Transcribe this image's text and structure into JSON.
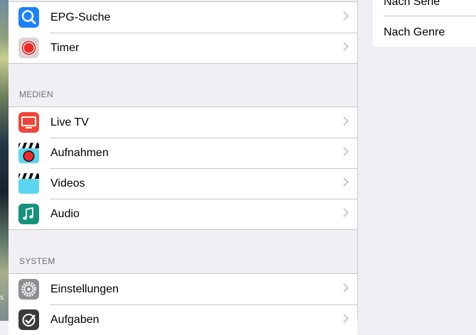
{
  "desktop": {
    "icon_label": "s"
  },
  "groups": [
    {
      "items": [
        {
          "label": "EPG-Suche",
          "icon": "search-icon"
        },
        {
          "label": "Timer",
          "icon": "record-icon"
        }
      ]
    },
    {
      "header": "MEDIEN",
      "items": [
        {
          "label": "Live TV",
          "icon": "tv-icon"
        },
        {
          "label": "Aufnahmen",
          "icon": "recordings-clapper-icon"
        },
        {
          "label": "Videos",
          "icon": "videos-clapper-icon"
        },
        {
          "label": "Audio",
          "icon": "music-note-icon"
        }
      ]
    },
    {
      "header": "SYSTEM",
      "items": [
        {
          "label": "Einstellungen",
          "icon": "gear-icon"
        },
        {
          "label": "Aufgaben",
          "icon": "tasks-check-icon"
        }
      ]
    }
  ],
  "right_panel": {
    "items": [
      "Nach Serie",
      "Nach Genre"
    ]
  },
  "colors": {
    "search_icon": "#1a82fb",
    "timer_icon": "#d0d0d0",
    "record_red": "#ef2b2b",
    "livetv_icon": "#f0453a",
    "video_cyan": "#5ad6f0",
    "audio_icon": "#14937c",
    "settings_icon": "#8e8e93",
    "tasks_icon": "#3b3b3b"
  }
}
